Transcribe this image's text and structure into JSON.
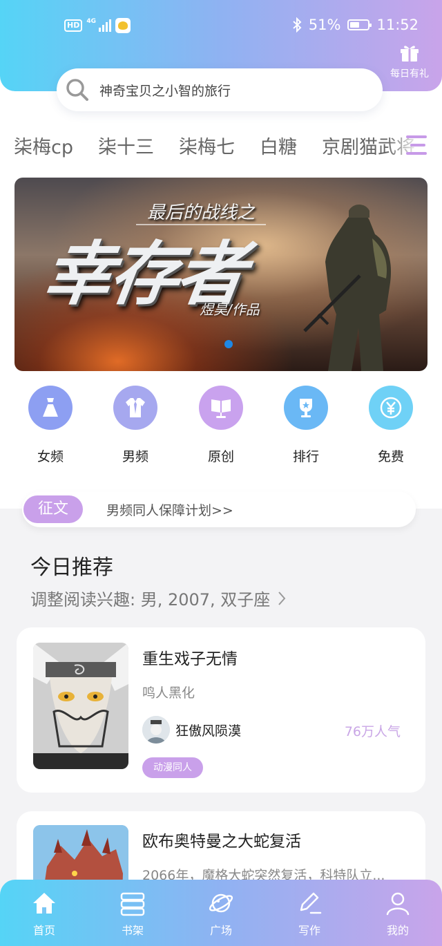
{
  "status_bar": {
    "hd": "HD",
    "network": "4G",
    "battery": "51%",
    "time": "11:52"
  },
  "gift": {
    "label": "每日有礼",
    "icon": "gift-icon"
  },
  "search": {
    "placeholder": "神奇宝贝之小智的旅行",
    "icon": "search-icon"
  },
  "tags": [
    "柒梅cp",
    "柒十三",
    "柒梅七",
    "白糖",
    "京剧猫武将",
    "更多"
  ],
  "banner": {
    "subtitle": "最后的战线之",
    "title": "幸存者",
    "author": "煜昊/作品",
    "active_slide": 1
  },
  "categories": [
    {
      "label": "女频",
      "icon": "dress-icon",
      "color": "#8d9ff2"
    },
    {
      "label": "男频",
      "icon": "shirt-icon",
      "color": "#a6a8ef"
    },
    {
      "label": "原创",
      "icon": "book-stand-icon",
      "color": "#c9a2ee"
    },
    {
      "label": "排行",
      "icon": "trophy-icon",
      "color": "#6ab8f5"
    },
    {
      "label": "免费",
      "icon": "yuan-coin-icon",
      "color": "#6fd1f6"
    }
  ],
  "notice": {
    "badge": "征文",
    "text": "男频同人保障计划>>"
  },
  "today": {
    "title": "今日推荐",
    "subtitle": "调整阅读兴趣: 男, 2007, 双子座"
  },
  "books": [
    {
      "title": "重生戏子无情",
      "desc": "鸣人黑化",
      "author": "狂傲风陨漠",
      "popularity": "76万人气",
      "genre": "动漫同人"
    },
    {
      "title": "欧布奥特曼之大蛇复活",
      "desc": "2066年，魔格大蛇突然复活，科特队立..."
    }
  ],
  "bottom_nav": [
    {
      "label": "首页",
      "icon": "home-icon"
    },
    {
      "label": "书架",
      "icon": "bookshelf-icon"
    },
    {
      "label": "广场",
      "icon": "planet-icon"
    },
    {
      "label": "写作",
      "icon": "pen-icon"
    },
    {
      "label": "我的",
      "icon": "user-icon"
    }
  ]
}
